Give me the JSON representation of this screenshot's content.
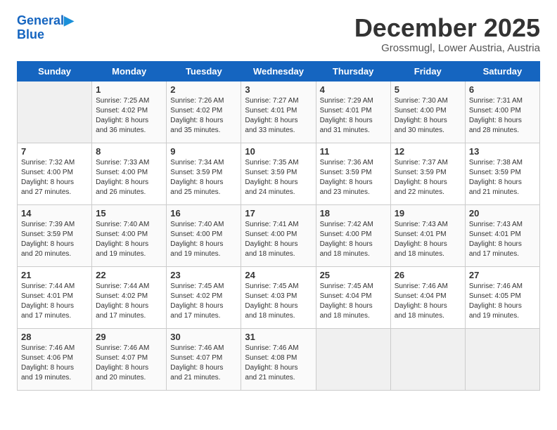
{
  "header": {
    "logo_line1": "General",
    "logo_line2": "Blue",
    "month": "December 2025",
    "location": "Grossmugl, Lower Austria, Austria"
  },
  "weekdays": [
    "Sunday",
    "Monday",
    "Tuesday",
    "Wednesday",
    "Thursday",
    "Friday",
    "Saturday"
  ],
  "weeks": [
    [
      {
        "day": "",
        "info": ""
      },
      {
        "day": "1",
        "info": "Sunrise: 7:25 AM\nSunset: 4:02 PM\nDaylight: 8 hours\nand 36 minutes."
      },
      {
        "day": "2",
        "info": "Sunrise: 7:26 AM\nSunset: 4:02 PM\nDaylight: 8 hours\nand 35 minutes."
      },
      {
        "day": "3",
        "info": "Sunrise: 7:27 AM\nSunset: 4:01 PM\nDaylight: 8 hours\nand 33 minutes."
      },
      {
        "day": "4",
        "info": "Sunrise: 7:29 AM\nSunset: 4:01 PM\nDaylight: 8 hours\nand 31 minutes."
      },
      {
        "day": "5",
        "info": "Sunrise: 7:30 AM\nSunset: 4:00 PM\nDaylight: 8 hours\nand 30 minutes."
      },
      {
        "day": "6",
        "info": "Sunrise: 7:31 AM\nSunset: 4:00 PM\nDaylight: 8 hours\nand 28 minutes."
      }
    ],
    [
      {
        "day": "7",
        "info": "Sunrise: 7:32 AM\nSunset: 4:00 PM\nDaylight: 8 hours\nand 27 minutes."
      },
      {
        "day": "8",
        "info": "Sunrise: 7:33 AM\nSunset: 4:00 PM\nDaylight: 8 hours\nand 26 minutes."
      },
      {
        "day": "9",
        "info": "Sunrise: 7:34 AM\nSunset: 3:59 PM\nDaylight: 8 hours\nand 25 minutes."
      },
      {
        "day": "10",
        "info": "Sunrise: 7:35 AM\nSunset: 3:59 PM\nDaylight: 8 hours\nand 24 minutes."
      },
      {
        "day": "11",
        "info": "Sunrise: 7:36 AM\nSunset: 3:59 PM\nDaylight: 8 hours\nand 23 minutes."
      },
      {
        "day": "12",
        "info": "Sunrise: 7:37 AM\nSunset: 3:59 PM\nDaylight: 8 hours\nand 22 minutes."
      },
      {
        "day": "13",
        "info": "Sunrise: 7:38 AM\nSunset: 3:59 PM\nDaylight: 8 hours\nand 21 minutes."
      }
    ],
    [
      {
        "day": "14",
        "info": "Sunrise: 7:39 AM\nSunset: 3:59 PM\nDaylight: 8 hours\nand 20 minutes."
      },
      {
        "day": "15",
        "info": "Sunrise: 7:40 AM\nSunset: 4:00 PM\nDaylight: 8 hours\nand 19 minutes."
      },
      {
        "day": "16",
        "info": "Sunrise: 7:40 AM\nSunset: 4:00 PM\nDaylight: 8 hours\nand 19 minutes."
      },
      {
        "day": "17",
        "info": "Sunrise: 7:41 AM\nSunset: 4:00 PM\nDaylight: 8 hours\nand 18 minutes."
      },
      {
        "day": "18",
        "info": "Sunrise: 7:42 AM\nSunset: 4:00 PM\nDaylight: 8 hours\nand 18 minutes."
      },
      {
        "day": "19",
        "info": "Sunrise: 7:43 AM\nSunset: 4:01 PM\nDaylight: 8 hours\nand 18 minutes."
      },
      {
        "day": "20",
        "info": "Sunrise: 7:43 AM\nSunset: 4:01 PM\nDaylight: 8 hours\nand 17 minutes."
      }
    ],
    [
      {
        "day": "21",
        "info": "Sunrise: 7:44 AM\nSunset: 4:01 PM\nDaylight: 8 hours\nand 17 minutes."
      },
      {
        "day": "22",
        "info": "Sunrise: 7:44 AM\nSunset: 4:02 PM\nDaylight: 8 hours\nand 17 minutes."
      },
      {
        "day": "23",
        "info": "Sunrise: 7:45 AM\nSunset: 4:02 PM\nDaylight: 8 hours\nand 17 minutes."
      },
      {
        "day": "24",
        "info": "Sunrise: 7:45 AM\nSunset: 4:03 PM\nDaylight: 8 hours\nand 18 minutes."
      },
      {
        "day": "25",
        "info": "Sunrise: 7:45 AM\nSunset: 4:04 PM\nDaylight: 8 hours\nand 18 minutes."
      },
      {
        "day": "26",
        "info": "Sunrise: 7:46 AM\nSunset: 4:04 PM\nDaylight: 8 hours\nand 18 minutes."
      },
      {
        "day": "27",
        "info": "Sunrise: 7:46 AM\nSunset: 4:05 PM\nDaylight: 8 hours\nand 19 minutes."
      }
    ],
    [
      {
        "day": "28",
        "info": "Sunrise: 7:46 AM\nSunset: 4:06 PM\nDaylight: 8 hours\nand 19 minutes."
      },
      {
        "day": "29",
        "info": "Sunrise: 7:46 AM\nSunset: 4:07 PM\nDaylight: 8 hours\nand 20 minutes."
      },
      {
        "day": "30",
        "info": "Sunrise: 7:46 AM\nSunset: 4:07 PM\nDaylight: 8 hours\nand 21 minutes."
      },
      {
        "day": "31",
        "info": "Sunrise: 7:46 AM\nSunset: 4:08 PM\nDaylight: 8 hours\nand 21 minutes."
      },
      {
        "day": "",
        "info": ""
      },
      {
        "day": "",
        "info": ""
      },
      {
        "day": "",
        "info": ""
      }
    ]
  ]
}
